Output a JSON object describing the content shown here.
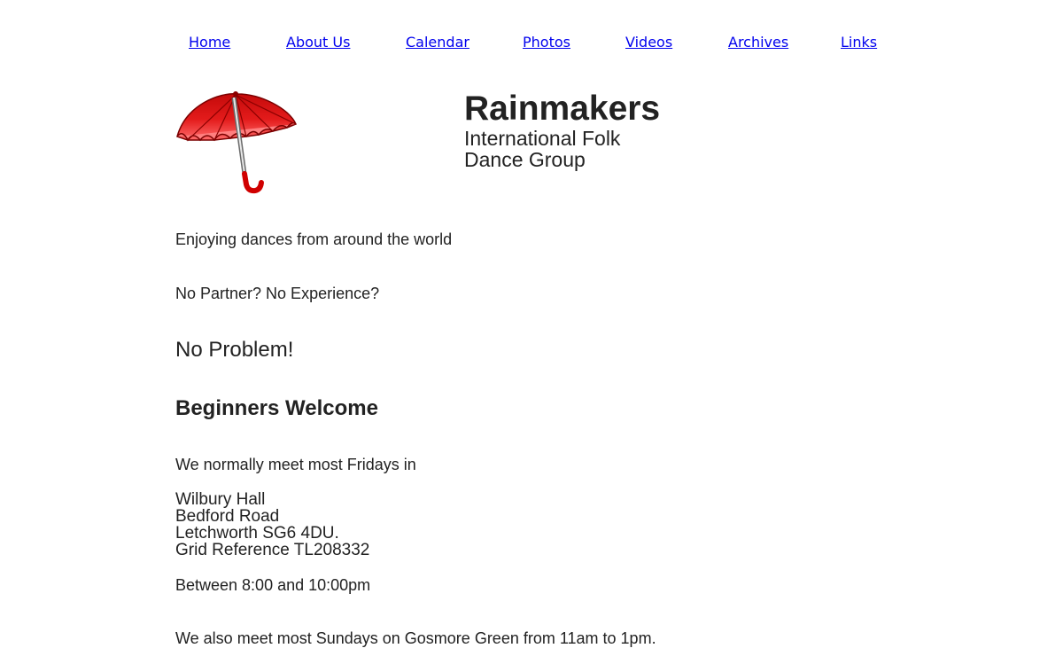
{
  "nav": {
    "items": [
      {
        "label": "Home"
      },
      {
        "label": "About Us"
      },
      {
        "label": "Calendar"
      },
      {
        "label": "Photos"
      },
      {
        "label": "Videos"
      },
      {
        "label": "Archives"
      },
      {
        "label": "Links"
      }
    ]
  },
  "header": {
    "logo_icon": "red-umbrella-icon",
    "title": "Rainmakers",
    "subtitle": "International Folk Dance Group"
  },
  "content": {
    "tagline": "Enjoying dances from around the world",
    "question": "No Partner? No Experience?",
    "answer": "No Problem!",
    "welcome_heading": "Beginners Welcome",
    "friday_intro": "We normally meet most Fridays in",
    "address": {
      "line1": "Wilbury Hall",
      "line2": "Bedford Road",
      "line3": "Letchworth SG6 4DU.",
      "line4": "Grid Reference TL208332"
    },
    "friday_time": "Between 8:00 and 10:00pm",
    "sunday": "We also meet most Sundays on Gosmore Green from 11am to 1pm."
  },
  "colors": {
    "link": "#0000ee",
    "text": "#222222",
    "umbrella": "#e01010"
  }
}
